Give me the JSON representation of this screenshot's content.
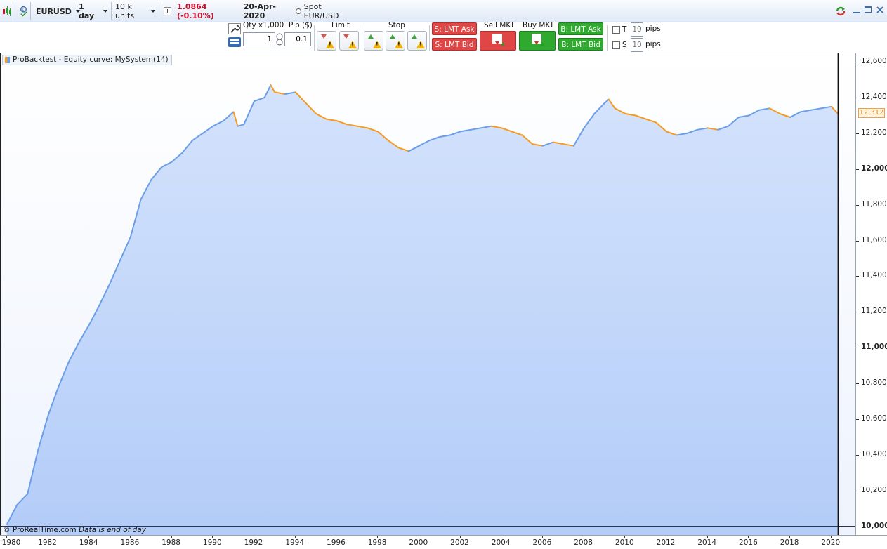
{
  "topbar": {
    "instrument": "EURUSD",
    "timeframe": "1 day",
    "units": "10 k units",
    "price_change": "1.0864 (-0.10%)",
    "date": "20-Apr-2020",
    "spot_label": "Spot EUR/USD"
  },
  "toolbar": {
    "qty_label": "Qty x1,000",
    "qty_value": "1",
    "pip_label": "Pip ($)",
    "pip_value": "0.1",
    "limit_label": "Limit",
    "stop_label": "Stop",
    "sell_lmt_ask": "S: LMT Ask",
    "sell_lmt_bid": "S: LMT Bid",
    "sell_mkt": "Sell MKT",
    "buy_mkt": "Buy MKT",
    "buy_lmt_ask": "B: LMT Ask",
    "buy_lmt_bid": "B: LMT Bid",
    "t_label": "T",
    "t_value": "10",
    "s_label": "S",
    "s_value": "10",
    "pips_label_1": "pips",
    "pips_label_2": "pips"
  },
  "chart": {
    "legend": "ProBacktest - Equity curve: MySystem(14)",
    "footer_brand": "© ProRealTime.com",
    "footer_note": "Data is end of day",
    "last_value_label": "12,312",
    "colors": {
      "area": "#bdd3fa",
      "line_up": "#6b9ee8",
      "line_down": "#f79a1e"
    }
  },
  "chart_data": {
    "type": "area",
    "title": "",
    "xlabel": "",
    "ylabel": "",
    "ylim": [
      9990,
      12640
    ],
    "xlim": [
      1979.7,
      2021.2
    ],
    "y_ticks": [
      "10,000",
      "10,200",
      "10,400",
      "10,600",
      "10,800",
      "11,000",
      "11,200",
      "11,400",
      "11,600",
      "11,800",
      "12,000",
      "12,200",
      "12,400",
      "12,600"
    ],
    "y_major": [
      "10,000",
      "11,000",
      "12,000"
    ],
    "x_ticks": [
      "1980",
      "1982",
      "1984",
      "1986",
      "1988",
      "1990",
      "1992",
      "1994",
      "1996",
      "1998",
      "2000",
      "2002",
      "2004",
      "2006",
      "2008",
      "2010",
      "2012",
      "2014",
      "2016",
      "2018",
      "2020"
    ],
    "last_value": 12312,
    "series": [
      {
        "x": [
          1980.0,
          1980.5,
          1981.0,
          1981.5,
          1982.0,
          1982.5,
          1983.0,
          1983.5,
          1984.0,
          1984.5,
          1985.0,
          1985.5,
          1986.0,
          1986.5,
          1987.0,
          1987.5,
          1988.0,
          1988.5,
          1989.0,
          1989.5,
          1990.0,
          1990.5,
          1991.0,
          1991.2,
          1991.5,
          1992.0,
          1992.5,
          1992.8,
          1993.0,
          1993.5,
          1994.0,
          1994.5,
          1995.0,
          1995.5,
          1996.0,
          1996.5,
          1997.0,
          1997.5,
          1998.0,
          1998.5,
          1999.0,
          1999.5,
          2000.0,
          2000.5,
          2001.0,
          2001.5,
          2002.0,
          2002.5,
          2003.0,
          2003.5,
          2004.0,
          2004.5,
          2005.0,
          2005.5,
          2006.0,
          2006.5,
          2007.0,
          2007.5,
          2008.0,
          2008.5,
          2009.0,
          2009.2,
          2009.5,
          2010.0,
          2010.5,
          2011.0,
          2011.5,
          2012.0,
          2012.5,
          2013.0,
          2013.5,
          2014.0,
          2014.5,
          2015.0,
          2015.5,
          2016.0,
          2016.5,
          2017.0,
          2017.5,
          2018.0,
          2018.5,
          2019.0,
          2019.5,
          2020.0,
          2020.3
        ],
        "y": [
          10010,
          10120,
          10180,
          10420,
          10620,
          10780,
          10920,
          11030,
          11130,
          11240,
          11360,
          11490,
          11620,
          11830,
          11940,
          12010,
          12040,
          12090,
          12160,
          12200,
          12240,
          12270,
          12320,
          12240,
          12250,
          12380,
          12400,
          12470,
          12430,
          12420,
          12430,
          12370,
          12310,
          12280,
          12270,
          12250,
          12240,
          12230,
          12210,
          12160,
          12120,
          12100,
          12130,
          12160,
          12180,
          12190,
          12210,
          12220,
          12230,
          12240,
          12230,
          12210,
          12190,
          12140,
          12130,
          12150,
          12140,
          12130,
          12230,
          12310,
          12370,
          12390,
          12340,
          12310,
          12300,
          12280,
          12260,
          12210,
          12190,
          12200,
          12220,
          12230,
          12220,
          12240,
          12290,
          12300,
          12330,
          12340,
          12310,
          12290,
          12320,
          12330,
          12340,
          12350,
          12312
        ]
      }
    ]
  }
}
